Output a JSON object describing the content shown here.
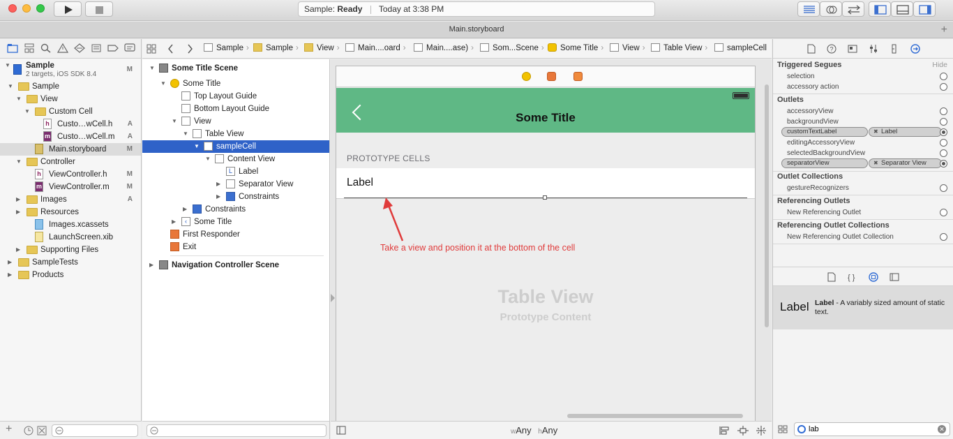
{
  "toolbar": {
    "scheme": "Sample",
    "status": "Ready",
    "status_prefix": "Sample: ",
    "time": "Today at 3:38 PM"
  },
  "tab": {
    "title": "Main.storyboard",
    "plus": "+"
  },
  "navigator": {
    "project": "Sample",
    "project_sub": "2 targets, iOS SDK 8.4",
    "project_badge": "M",
    "items": [
      {
        "label": "Sample",
        "kind": "folder",
        "badge": ""
      },
      {
        "label": "View",
        "kind": "folder",
        "badge": ""
      },
      {
        "label": "Custom Cell",
        "kind": "folder",
        "badge": ""
      },
      {
        "label": "Custo…wCell.h",
        "kind": "h",
        "badge": "A"
      },
      {
        "label": "Custo…wCell.m",
        "kind": "m",
        "badge": "A"
      },
      {
        "label": "Main.storyboard",
        "kind": "storyboard",
        "badge": "M"
      },
      {
        "label": "Controller",
        "kind": "folder",
        "badge": ""
      },
      {
        "label": "ViewController.h",
        "kind": "h",
        "badge": "M"
      },
      {
        "label": "ViewController.m",
        "kind": "m",
        "badge": "M"
      },
      {
        "label": "Images",
        "kind": "folder",
        "badge": "A"
      },
      {
        "label": "Resources",
        "kind": "folder",
        "badge": ""
      },
      {
        "label": "Images.xcassets",
        "kind": "assets",
        "badge": ""
      },
      {
        "label": "LaunchScreen.xib",
        "kind": "xib",
        "badge": ""
      },
      {
        "label": "Supporting Files",
        "kind": "folder",
        "badge": ""
      },
      {
        "label": "SampleTests",
        "kind": "folder",
        "badge": ""
      },
      {
        "label": "Products",
        "kind": "folder",
        "badge": ""
      }
    ]
  },
  "jumpbar": {
    "crumbs": [
      "Sample",
      "Sample",
      "View",
      "Main....oard",
      "Main....ase)",
      "Som...Scene",
      "Some Title",
      "View",
      "Table View",
      "sampleCell"
    ]
  },
  "outline": {
    "rows": [
      "Some Title Scene",
      "Some Title",
      "Top Layout Guide",
      "Bottom Layout Guide",
      "View",
      "Table View",
      "sampleCell",
      "Content View",
      "Label",
      "Separator View",
      "Constraints",
      "Constraints",
      "Some Title",
      "First Responder",
      "Exit",
      "Navigation Controller Scene"
    ]
  },
  "canvas": {
    "nav_title": "Some Title",
    "prototype_header": "PROTOTYPE CELLS",
    "cell_label": "Label",
    "annotation": "Take a view and position it at the bottom of the cell",
    "tv_title": "Table View",
    "tv_sub": "Prototype Content",
    "size_w_prefix": "w",
    "size_w": "Any",
    "size_h_prefix": "h",
    "size_h": "Any"
  },
  "inspector": {
    "triggered_segues": "Triggered Segues",
    "hide": "Hide",
    "segues": [
      "selection",
      "accessory action"
    ],
    "outlets_title": "Outlets",
    "outlets": [
      "accessoryView",
      "backgroundView",
      "customTextLabel",
      "editingAccessoryView",
      "selectedBackgroundView",
      "separatorView"
    ],
    "connected": {
      "customTextLabel": "Label",
      "separatorView": "Separator View"
    },
    "outlet_collections": "Outlet Collections",
    "gesture": "gestureRecognizers",
    "ref_outlets": "Referencing Outlets",
    "new_ref_outlet": "New Referencing Outlet",
    "ref_outlet_collections": "Referencing Outlet Collections",
    "new_ref_outlet_collection": "New Referencing Outlet Collection"
  },
  "library": {
    "big_label": "Label",
    "name": "Label",
    "desc": " - A variably sized amount of static text.",
    "search": "lab"
  },
  "colors": {
    "nav_green": "#5fb885",
    "selection_blue": "#2f62c8",
    "annotation_red": "#e03b3b"
  }
}
